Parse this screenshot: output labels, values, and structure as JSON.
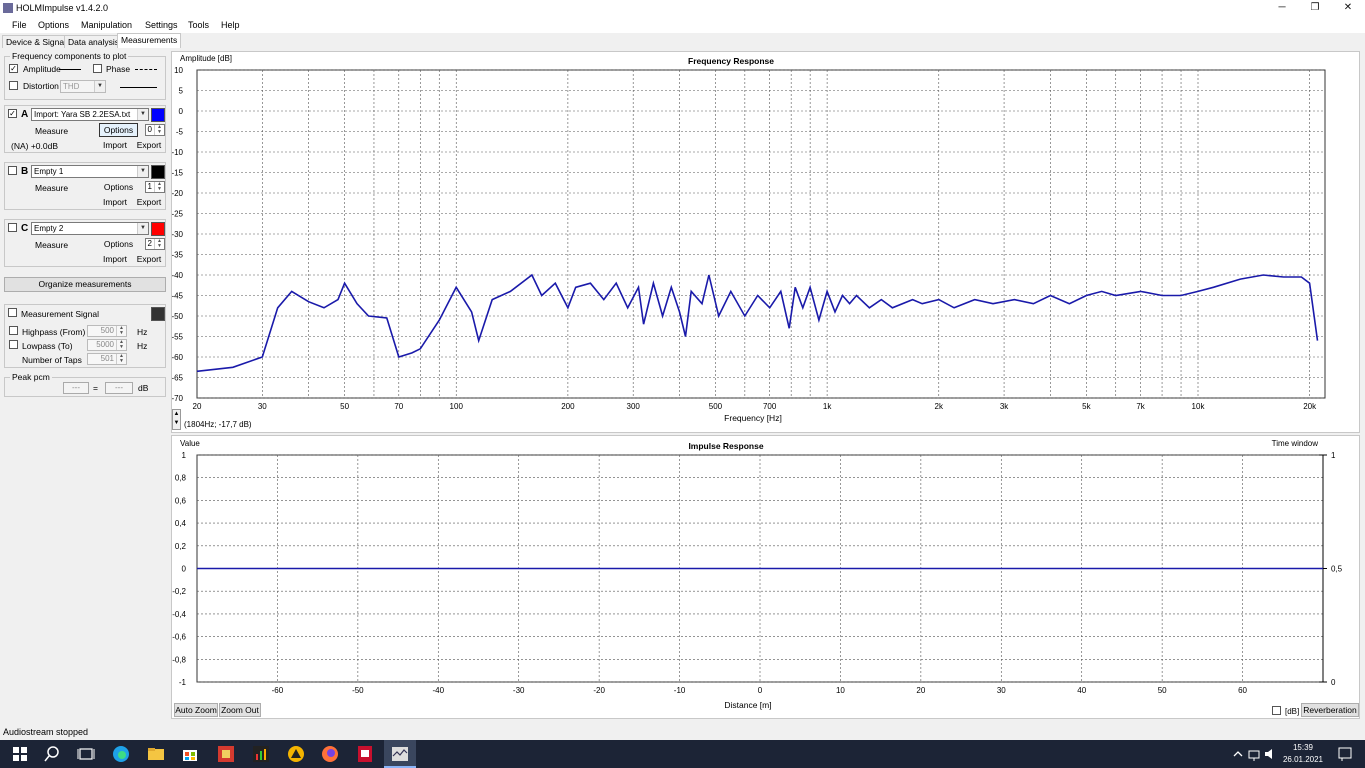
{
  "window": {
    "title": "HOLMImpulse  v1.4.2.0",
    "min_glyph": "─",
    "max_glyph": "❐",
    "close_glyph": "✕"
  },
  "menu": [
    "File",
    "Options",
    "Manipulation",
    "Settings",
    "Tools",
    "Help"
  ],
  "tabs": [
    "Device & Signal",
    "Data analysis",
    "Measurements"
  ],
  "components": {
    "title": "Frequency components to plot",
    "amplitude": {
      "label": "Amplitude",
      "checked": true
    },
    "phase": {
      "label": "Phase",
      "checked": false
    },
    "distortion": {
      "label": "Distortion",
      "checked": false,
      "selected": "THD"
    }
  },
  "channels": [
    {
      "letter": "A",
      "checked": true,
      "source": "Import: Yara SB 2.2ESA.txt",
      "color": "#0000ff",
      "number": "0",
      "info": "(NA) +0.0dB"
    },
    {
      "letter": "B",
      "checked": false,
      "source": "Empty 1",
      "color": "#000000",
      "number": "1",
      "info": ""
    },
    {
      "letter": "C",
      "checked": false,
      "source": "Empty 2",
      "color": "#ff0000",
      "number": "2",
      "info": ""
    }
  ],
  "channel_buttons": {
    "measure": "Measure",
    "options": "Options",
    "import": "Import",
    "export": "Export"
  },
  "organize_label": "Organize measurements",
  "signal": {
    "title": "Measurement Signal",
    "swatch": "#333333",
    "highpass": {
      "label": "Highpass (From)",
      "value": "500",
      "unit": "Hz"
    },
    "lowpass": {
      "label": "Lowpass (To)",
      "value": "5000",
      "unit": "Hz"
    },
    "taps": {
      "label": "Number of Taps",
      "value": "501"
    }
  },
  "peak": {
    "title": "Peak pcm",
    "equals": "=",
    "unit": "dB",
    "field_a": "---",
    "field_b": "---"
  },
  "freq_chart": {
    "cursor_readout": "(1804Hz; -17,7 dB)"
  },
  "impulse_toolbar": {
    "auto_zoom": "Auto Zoom",
    "zoom_out": "Zoom Out",
    "db_label": "[dB]",
    "reverberation": "Reverberation"
  },
  "status": "Audiostream stopped",
  "taskbar": {
    "time": "15:39",
    "date": "26.01.2021"
  },
  "colors": {
    "trace": "#1a1aaa",
    "grid": "#555555"
  },
  "chart_data": [
    {
      "type": "line",
      "title": "Frequency Response",
      "xlabel": "Frequency [Hz]",
      "ylabel": "Amplitude [dB]",
      "xscale": "log",
      "xlim": [
        20,
        22000
      ],
      "ylim": [
        -70,
        10
      ],
      "grid": true,
      "x_ticks": [
        "20",
        "30",
        "50",
        "70",
        "100",
        "200",
        "300",
        "500",
        "700",
        "1k",
        "2k",
        "3k",
        "5k",
        "7k",
        "10k",
        "20k"
      ],
      "y_ticks": [
        "10",
        "5",
        "0",
        "-5",
        "-10",
        "-15",
        "-20",
        "-25",
        "-30",
        "-35",
        "-40",
        "-45",
        "-50",
        "-55",
        "-60",
        "-65",
        "-70"
      ],
      "series": [
        {
          "color": "#1a1aaa",
          "x": [
            20,
            25,
            30,
            33,
            36,
            40,
            44,
            48,
            50,
            54,
            58,
            65,
            70,
            76,
            80,
            90,
            100,
            110,
            115,
            125,
            140,
            160,
            170,
            185,
            200,
            210,
            230,
            250,
            270,
            290,
            310,
            320,
            340,
            360,
            380,
            400,
            415,
            430,
            460,
            480,
            510,
            550,
            600,
            650,
            700,
            750,
            790,
            820,
            860,
            900,
            950,
            1000,
            1050,
            1100,
            1150,
            1200,
            1300,
            1400,
            1500,
            1700,
            1804,
            2000,
            2200,
            2500,
            2800,
            3200,
            3600,
            4000,
            4500,
            5000,
            5500,
            6000,
            7000,
            8000,
            9000,
            10000,
            11000,
            13000,
            15000,
            17000,
            19000,
            20000,
            21000
          ],
          "y": [
            -63.5,
            -62.5,
            -60,
            -48,
            -44,
            -46.5,
            -48,
            -46,
            -42,
            -47,
            -50,
            -50.5,
            -60,
            -59,
            -58,
            -51,
            -43,
            -49,
            -56,
            -46,
            -44,
            -40,
            -45,
            -42,
            -48,
            -43,
            -42,
            -46,
            -42,
            -48,
            -43,
            -52,
            -42,
            -50,
            -43,
            -49,
            -55,
            -44,
            -47,
            -40,
            -50,
            -44,
            -50,
            -45,
            -48,
            -44,
            -53,
            -43,
            -48,
            -43,
            -51,
            -44,
            -49,
            -45,
            -47,
            -45,
            -48,
            -46,
            -48,
            -46,
            -47,
            -46,
            -48,
            -46,
            -47,
            -46,
            -47,
            -45,
            -47,
            -45,
            -44,
            -45,
            -44,
            -45,
            -45,
            -44,
            -43,
            -41,
            -40,
            -40.5,
            -40.5,
            -42,
            -56
          ]
        }
      ]
    },
    {
      "type": "line",
      "title": "Impulse Response",
      "xlabel": "Distance [m]",
      "ylabel": "Value",
      "y2label": "Time window",
      "xlim": [
        -70,
        70
      ],
      "ylim": [
        -1,
        1
      ],
      "y2lim": [
        0,
        1
      ],
      "grid": true,
      "x_ticks": [
        "-60",
        "-50",
        "-40",
        "-30",
        "-20",
        "-10",
        "0",
        "10",
        "20",
        "30",
        "40",
        "50",
        "60"
      ],
      "y_ticks": [
        "1",
        "0,8",
        "0,6",
        "0,4",
        "0,2",
        "0",
        "-0,2",
        "-0,4",
        "-0,6",
        "-0,8",
        "-1"
      ],
      "y2_ticks": [
        "1",
        "0,5",
        "0"
      ],
      "series": [
        {
          "color": "#1a1aaa",
          "x": [
            -70,
            70
          ],
          "y": [
            0,
            0
          ]
        }
      ]
    }
  ]
}
